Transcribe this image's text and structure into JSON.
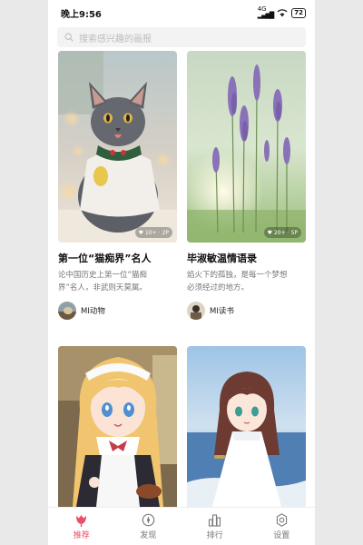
{
  "status_bar": {
    "time": "晚上9:56",
    "signal": "4G",
    "battery": "72"
  },
  "search": {
    "placeholder": "搜索感兴趣的画报"
  },
  "cards": [
    {
      "likes": "10+",
      "pages": "2P",
      "title": "第一位“猫痴界”名人",
      "desc_line1": "论中国历史上第一位“猫痴",
      "desc_line2": "界”名人，非武则天莫属。",
      "author": "MI动物"
    },
    {
      "likes": "20+",
      "pages": "5P",
      "title": "毕淑敏温情语录",
      "desc_line1": "焰火下的孤独，是每一个梦想",
      "desc_line2": "必须经过的地方。",
      "author": "MI读书"
    },
    {
      "title": ""
    },
    {
      "title": ""
    }
  ],
  "nav": [
    {
      "label": "推荐",
      "active": true
    },
    {
      "label": "发现"
    },
    {
      "label": "排行"
    },
    {
      "label": "设置"
    }
  ],
  "colors": {
    "accent": "#e84f6b"
  }
}
